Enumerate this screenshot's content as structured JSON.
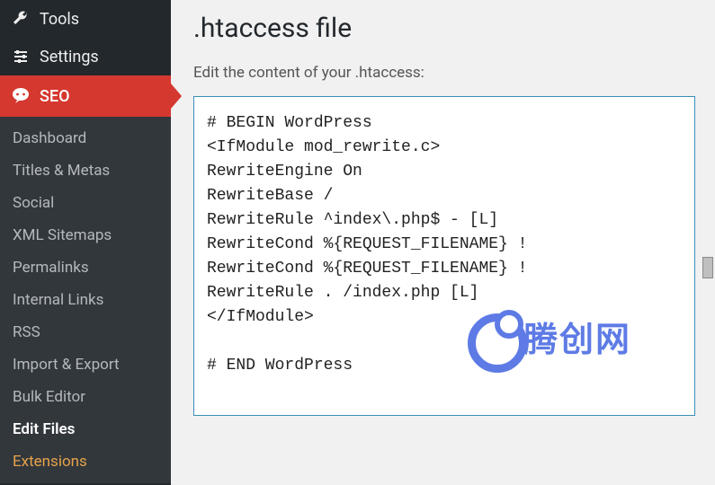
{
  "sidebar": {
    "top": [
      {
        "label": "Tools",
        "icon": "wrench"
      },
      {
        "label": "Settings",
        "icon": "sliders"
      }
    ],
    "seo": {
      "label": "SEO",
      "icon": "bubble"
    },
    "sub": [
      {
        "label": "Dashboard"
      },
      {
        "label": "Titles & Metas"
      },
      {
        "label": "Social"
      },
      {
        "label": "XML Sitemaps"
      },
      {
        "label": "Permalinks"
      },
      {
        "label": "Internal Links"
      },
      {
        "label": "RSS"
      },
      {
        "label": "Import & Export"
      },
      {
        "label": "Bulk Editor"
      },
      {
        "label": "Edit Files",
        "current": true
      },
      {
        "label": "Extensions",
        "highlight": true
      }
    ]
  },
  "page": {
    "title": ".htaccess file",
    "description": "Edit the content of your .htaccess:",
    "htaccess_content": "# BEGIN WordPress\n<IfModule mod_rewrite.c>\nRewriteEngine On\nRewriteBase /\nRewriteRule ^index\\.php$ - [L]\nRewriteCond %{REQUEST_FILENAME} !\nRewriteCond %{REQUEST_FILENAME} !\nRewriteRule . /index.php [L]\n</IfModule>\n\n# END WordPress\n"
  },
  "watermark": {
    "text": "腾创网"
  }
}
